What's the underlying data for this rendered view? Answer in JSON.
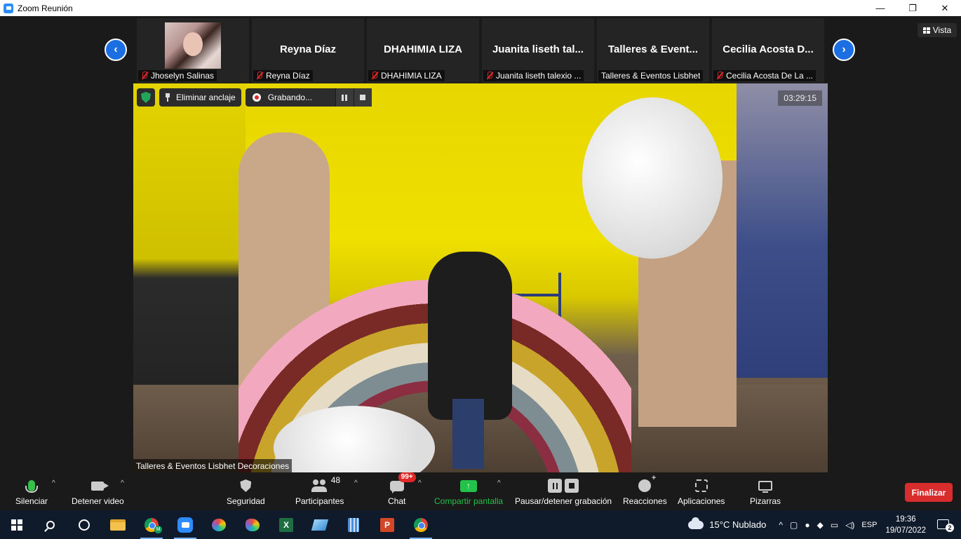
{
  "window": {
    "title": "Zoom Reunión",
    "controls": {
      "minimize": "—",
      "restore": "❐",
      "close": "✕"
    }
  },
  "view_button": {
    "label": "Vista"
  },
  "participants_strip": [
    {
      "display_name": "",
      "label": "Jhoselyn Salinas",
      "has_photo": true,
      "muted": true
    },
    {
      "display_name": "Reyna Díaz",
      "label": "Reyna Díaz",
      "has_photo": false,
      "muted": true
    },
    {
      "display_name": "DHAHIMIA LIZA",
      "label": "DHAHIMIA LIZA",
      "has_photo": false,
      "muted": true
    },
    {
      "display_name": "Juanita liseth tal...",
      "label": "Juanita liseth talexio ...",
      "has_photo": false,
      "muted": true
    },
    {
      "display_name": "Talleres & Event...",
      "label": "Talleres & Eventos Lisbhet",
      "has_photo": false,
      "muted": false
    },
    {
      "display_name": "Cecilia Acosta D...",
      "label": "Cecilia Acosta De La ...",
      "has_photo": false,
      "muted": true
    }
  ],
  "main_video": {
    "pin_label": "Eliminar anclaje",
    "recording_label": "Grabando...",
    "timer": "03:29:15",
    "speaker_name": "Talleres & Eventos Lisbhet Decoraciones"
  },
  "toolbar": {
    "mute_label": "Silenciar",
    "video_label": "Detener video",
    "security_label": "Seguridad",
    "participants_label": "Participantes",
    "participants_count": "48",
    "chat_label": "Chat",
    "chat_badge": "99+",
    "share_label": "Compartir pantalla",
    "record_label": "Pausar/detener grabación",
    "reactions_label": "Reacciones",
    "apps_label": "Aplicaciones",
    "whiteboards_label": "Pizarras",
    "end_label": "Finalizar",
    "caret": "^"
  },
  "taskbar": {
    "weather": "15°C  Nublado",
    "language": "ESP",
    "time": "19:36",
    "date": "19/07/2022",
    "notifications": "2",
    "chrome_profile_badge": "M"
  },
  "colors": {
    "zoom_blue": "#2d8cff",
    "share_green": "#23c24a",
    "end_red": "#d92c2c",
    "muted_red": "#e02828"
  }
}
